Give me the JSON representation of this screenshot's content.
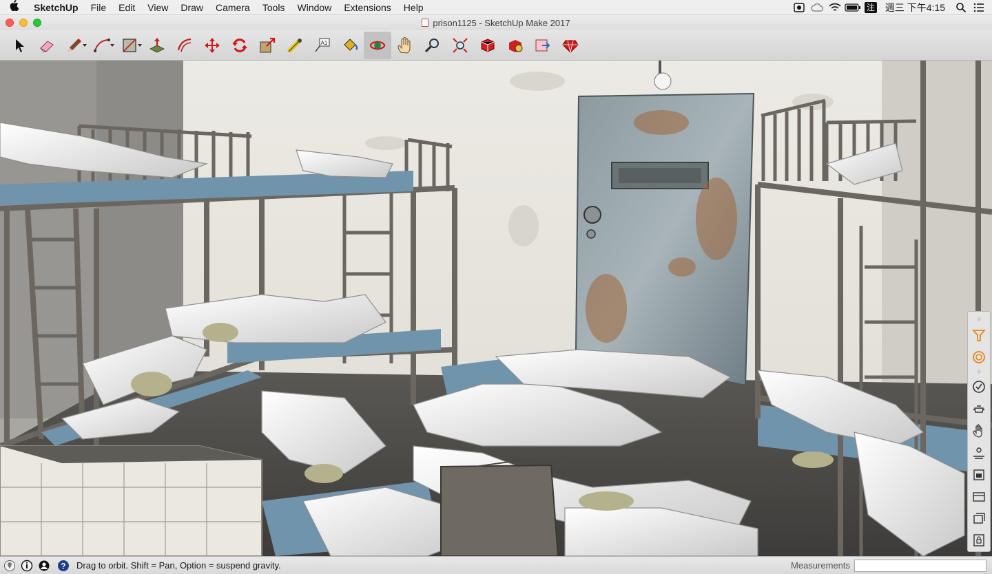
{
  "menubar": {
    "apple": "",
    "items": [
      "SketchUp",
      "File",
      "Edit",
      "View",
      "Draw",
      "Camera",
      "Tools",
      "Window",
      "Extensions",
      "Help"
    ],
    "input_method": "注",
    "clock": "週三 下午4:15"
  },
  "window": {
    "title": "prison1125 - SketchUp Make 2017"
  },
  "toolbar": {
    "tools": [
      "select-tool",
      "eraser-tool",
      "pencil-tool",
      "arc-tool",
      "rectangle-tool",
      "push-pull-tool",
      "offset-tool",
      "move-tool",
      "rotate-tool",
      "scale-tool",
      "tape-measure-tool",
      "text-tool",
      "paint-bucket-tool",
      "orbit-tool",
      "pan-tool",
      "zoom-tool",
      "zoom-extents-tool",
      "3d-warehouse-tool",
      "extension-warehouse-tool",
      "layout-send-tool",
      "extension-manager-tool"
    ],
    "active_tool": "orbit-tool",
    "text_tool_glyph": "A1"
  },
  "tray": {
    "icons": [
      "styles-icon",
      "materials-icon",
      "components-check-icon",
      "teapot-icon",
      "hand-icon",
      "shadows-icon",
      "scenes-icon",
      "layers-icon",
      "outliner-icon",
      "lock-icon"
    ]
  },
  "statusbar": {
    "hint": "Drag to orbit. Shift = Pan, Option = suspend gravity.",
    "measurements_label": "Measurements",
    "measurements_value": ""
  },
  "colors": {
    "accent_orange": "#e8841a",
    "door_steel": "#7d8e98",
    "wall": "#e8e6e0",
    "mattress": "#6c8fa8"
  }
}
